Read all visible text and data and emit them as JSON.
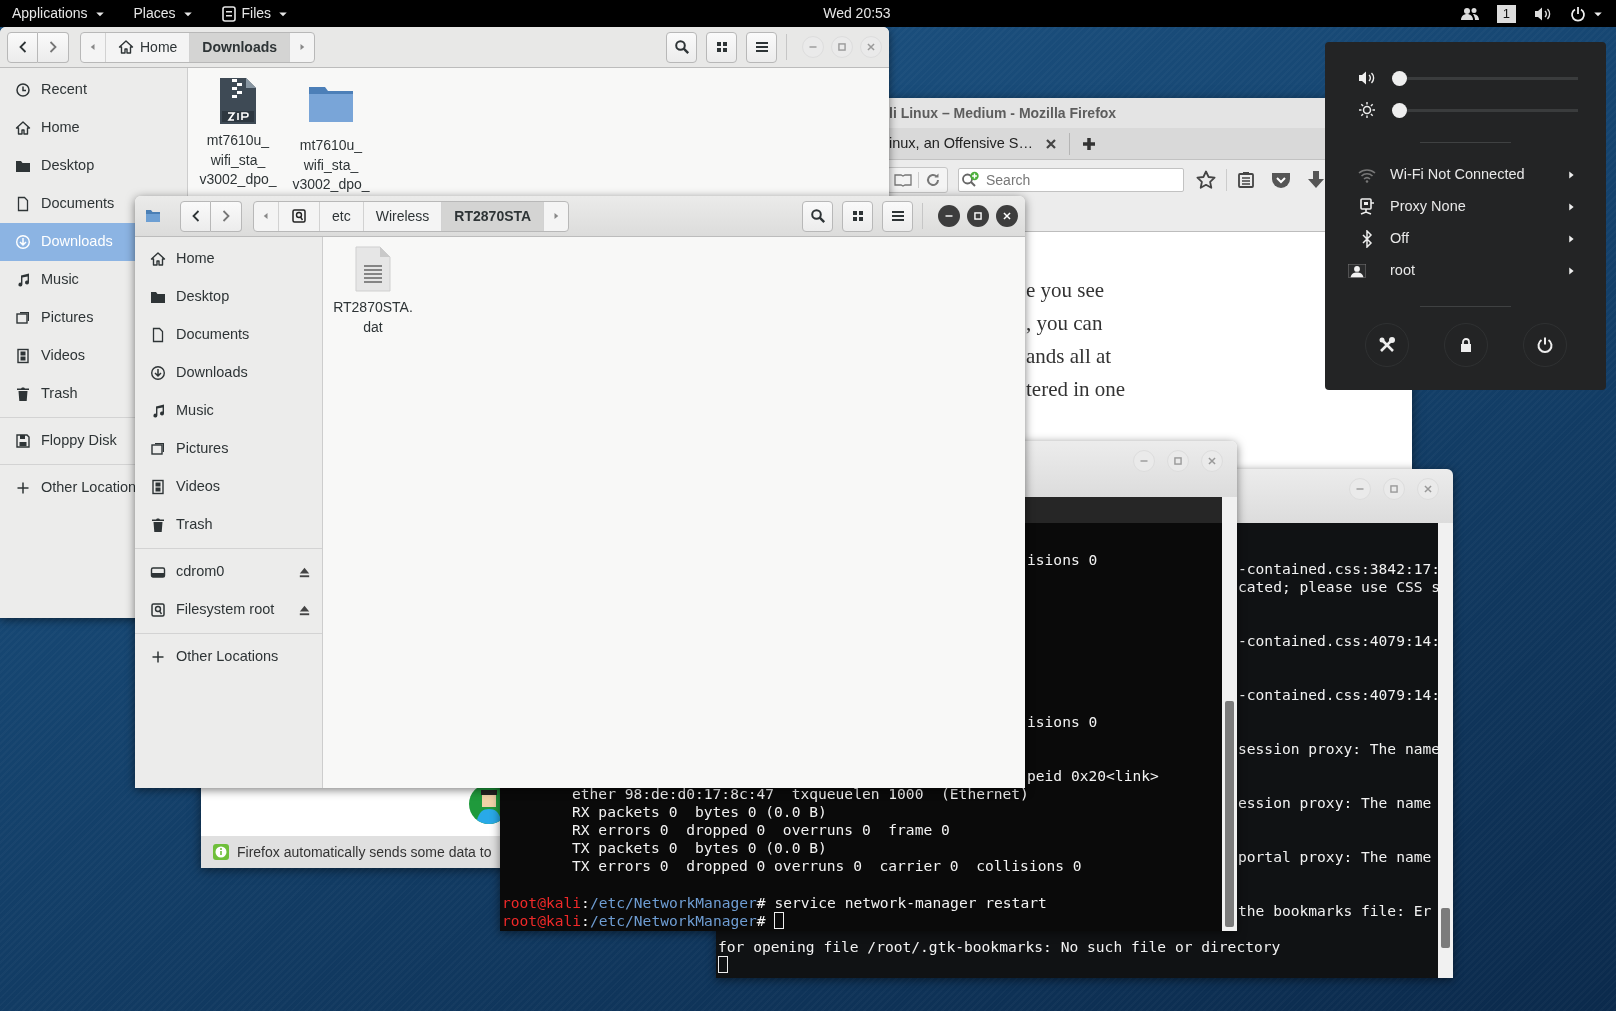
{
  "top_bar": {
    "menus": [
      {
        "kind": "menu",
        "label": "Applications"
      },
      {
        "kind": "menu",
        "label": "Places"
      },
      {
        "kind": "app",
        "label": "Files"
      }
    ],
    "clock": "Wed 20:53",
    "workspace": "1"
  },
  "firefox": {
    "title": "li Linux – Medium - Mozilla Firefox",
    "tab": "inux, an Offensive S…",
    "search": {
      "placeholder": "Search"
    },
    "article_lines": [
      "e you see",
      ", you can",
      "ands all at",
      "tered in one"
    ],
    "notification": "Firefox automatically sends some data to"
  },
  "terminal_back": {
    "fragments": [
      "-contained.css:3842:17:",
      "cated; please use CSS s",
      "-contained.css:4079:14:",
      "-contained.css:4079:14:",
      "session proxy: The name",
      "ession proxy: The name",
      "portal proxy: The name",
      "the bookmarks file: Er"
    ],
    "lines": [
      "for opening file /root/.gtk-bookmarks: No such file or directory"
    ],
    "cursor": true
  },
  "terminal_front": {
    "fragments": [
      "isions 0",
      "isions 0",
      "peid 0x20<link>"
    ],
    "lines": [
      {
        "kind": "output",
        "text": "ether 98:de:d0:17:8c:47  txqueuelen 1000  (Ethernet)"
      },
      {
        "kind": "output",
        "text": "RX packets 0  bytes 0 (0.0 B)"
      },
      {
        "kind": "output",
        "text": "RX errors 0  dropped 0  overruns 0  frame 0"
      },
      {
        "kind": "output",
        "text": "TX packets 0  bytes 0 (0.0 B)"
      },
      {
        "kind": "output",
        "text": "TX errors 0  dropped 0 overruns 0  carrier 0  collisions 0"
      },
      {
        "kind": "prompt",
        "user": "root@kali",
        "colon": ":",
        "path": "/etc/NetworkManager",
        "symbol": "#",
        "command": "service network-manager restart",
        "cursor": false
      },
      {
        "kind": "prompt",
        "user": "root@kali",
        "colon": ":",
        "path": "/etc/NetworkManager",
        "symbol": "#",
        "cursor": true
      }
    ]
  },
  "file_manager_back": {
    "active": false,
    "path": [
      {
        "kind": "home",
        "label": "Home",
        "selected": false
      },
      {
        "kind": "crumb",
        "label": "Downloads",
        "selected": true
      }
    ],
    "sidebar": [
      {
        "items": [
          {
            "kind": "recent",
            "label": "Recent",
            "selected": false
          },
          {
            "kind": "home",
            "label": "Home",
            "selected": false
          },
          {
            "kind": "desktop",
            "label": "Desktop",
            "selected": false
          },
          {
            "kind": "documents",
            "label": "Documents",
            "selected": false
          },
          {
            "kind": "downloads",
            "label": "Downloads",
            "selected": true
          },
          {
            "kind": "music",
            "label": "Music",
            "selected": false
          },
          {
            "kind": "pictures",
            "label": "Pictures",
            "selected": false
          },
          {
            "kind": "videos",
            "label": "Videos",
            "selected": false
          },
          {
            "kind": "trash",
            "label": "Trash",
            "selected": false
          }
        ]
      },
      {
        "items": [
          {
            "kind": "floppy",
            "label": "Floppy Disk",
            "selected": false
          }
        ]
      },
      {
        "items": [
          {
            "kind": "other",
            "label": "Other Location",
            "selected": false
          }
        ]
      }
    ],
    "files": [
      {
        "kind": "zip",
        "label_lines": [
          "mt7610u_",
          "wifi_sta_",
          "v3002_dpo_"
        ]
      },
      {
        "kind": "folder",
        "label_lines": [
          "mt7610u_",
          "wifi_sta_",
          "v3002_dpo_"
        ]
      }
    ]
  },
  "file_manager_front": {
    "active": true,
    "path": [
      {
        "kind": "drive",
        "selected": false
      },
      {
        "kind": "crumb",
        "label": "etc",
        "selected": false
      },
      {
        "kind": "crumb",
        "label": "Wireless",
        "selected": false
      },
      {
        "kind": "crumb",
        "label": "RT2870STA",
        "selected": true
      }
    ],
    "sidebar": [
      {
        "items": [
          {
            "kind": "home",
            "label": "Home",
            "selected": false
          },
          {
            "kind": "desktop",
            "label": "Desktop",
            "selected": false
          },
          {
            "kind": "documents",
            "label": "Documents",
            "selected": false
          },
          {
            "kind": "downloads",
            "label": "Downloads",
            "selected": false
          },
          {
            "kind": "music",
            "label": "Music",
            "selected": false
          },
          {
            "kind": "pictures",
            "label": "Pictures",
            "selected": false
          },
          {
            "kind": "videos",
            "label": "Videos",
            "selected": false
          },
          {
            "kind": "trash",
            "label": "Trash",
            "selected": false
          }
        ]
      },
      {
        "items": [
          {
            "kind": "disk",
            "label": "cdrom0",
            "selected": false,
            "eject": true
          },
          {
            "kind": "filesystem",
            "label": "Filesystem root",
            "selected": false,
            "eject": true
          }
        ]
      },
      {
        "items": [
          {
            "kind": "other",
            "label": "Other Locations",
            "selected": false
          }
        ]
      }
    ],
    "files": [
      {
        "kind": "text",
        "label_lines": [
          "RT2870STA.",
          "dat"
        ]
      }
    ]
  },
  "system_menu": {
    "sliders": [
      {
        "kind": "volume",
        "level": 0
      },
      {
        "kind": "brightness",
        "level": 0
      }
    ],
    "items": [
      {
        "kind": "wifi",
        "label": "Wi-Fi Not Connected"
      },
      {
        "kind": "proxy",
        "label": "Proxy None"
      },
      {
        "kind": "bluetooth",
        "label": "Off"
      },
      {
        "kind": "user",
        "label": "root"
      }
    ]
  }
}
